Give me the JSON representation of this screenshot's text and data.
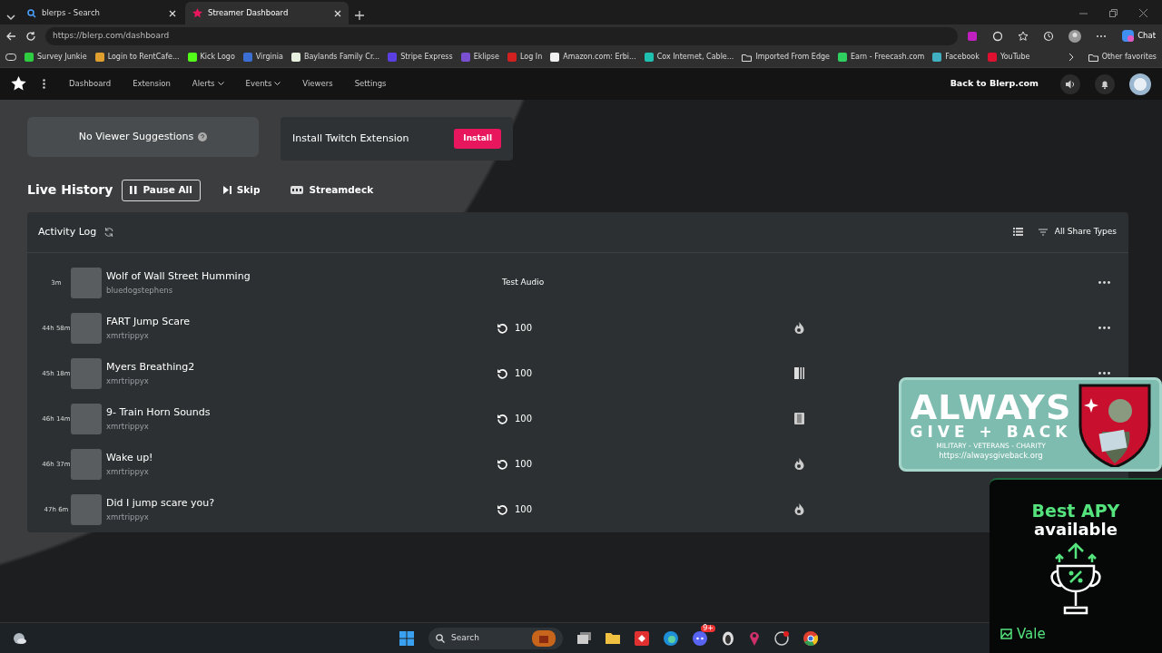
{
  "browser": {
    "tabs": [
      {
        "title": "blerps - Search",
        "selected": false
      },
      {
        "title": "Streamer Dashboard",
        "selected": true
      }
    ],
    "url": "https://blerp.com/dashboard",
    "bookmarks": [
      {
        "label": "Survey Junkie",
        "kind": "site",
        "color": "#2ecc40"
      },
      {
        "label": "Login to RentCafe...",
        "kind": "site",
        "color": "#e0a030"
      },
      {
        "label": "Kick Logo",
        "kind": "site",
        "color": "#53fc18"
      },
      {
        "label": "Virginia",
        "kind": "site",
        "color": "#3b6fd4"
      },
      {
        "label": "Baylands Family Cr...",
        "kind": "site",
        "color": "#e8f0e0"
      },
      {
        "label": "Stripe Express",
        "kind": "site",
        "color": "#5b3fe0"
      },
      {
        "label": "Eklipse",
        "kind": "site",
        "color": "#7a4fd0"
      },
      {
        "label": "Log In",
        "kind": "site",
        "color": "#d02020"
      },
      {
        "label": "Amazon.com: Erbi...",
        "kind": "site",
        "color": "#f0f0f0"
      },
      {
        "label": "Cox Internet, Cable...",
        "kind": "site",
        "color": "#20c0b0"
      },
      {
        "label": "Imported From Edge",
        "kind": "folder"
      },
      {
        "label": "Earn - Freecash.com",
        "kind": "site",
        "color": "#30d060"
      },
      {
        "label": "Facebook",
        "kind": "site",
        "color": "#40b0c0"
      },
      {
        "label": "YouTube",
        "kind": "site",
        "color": "#e01030"
      }
    ],
    "other_favorites": "Other favorites",
    "chat": "Chat"
  },
  "nav": {
    "links": [
      {
        "label": "Dashboard",
        "dropdown": false
      },
      {
        "label": "Extension",
        "dropdown": false
      },
      {
        "label": "Alerts",
        "dropdown": true
      },
      {
        "label": "Events",
        "dropdown": true
      },
      {
        "label": "Viewers",
        "dropdown": false
      },
      {
        "label": "Settings",
        "dropdown": false
      }
    ],
    "back_link": "Back to Blerp.com"
  },
  "suggestions": {
    "text": "No Viewer Suggestions"
  },
  "install": {
    "text": "Install Twitch Extension",
    "button": "Install"
  },
  "live_history": {
    "title": "Live History",
    "actions": [
      {
        "label": "Pause All",
        "kind": "pause",
        "outlined": true
      },
      {
        "label": "Skip",
        "kind": "skip",
        "outlined": false
      },
      {
        "label": "Streamdeck",
        "kind": "deck",
        "outlined": false
      }
    ]
  },
  "activity_log": {
    "title": "Activity Log",
    "filter": "All Share Types",
    "rows": [
      {
        "time": "3m",
        "title": "Wolf of Wall Street Humming",
        "user": "bluedogstephens",
        "kind": "test",
        "label": "Test Audio",
        "has_menu": true
      },
      {
        "time": "44h 58m",
        "title": "FART Jump Scare",
        "user": "xmrtrippyx",
        "kind": "volume",
        "label": "100",
        "media": {
          "kind": "flame"
        },
        "has_menu": true
      },
      {
        "time": "45h 18m",
        "title": "Myers Breathing2",
        "user": "xmrtrippyx",
        "kind": "volume",
        "label": "100",
        "media": {
          "kind": "bars"
        },
        "has_menu": true
      },
      {
        "time": "46h 14m",
        "title": "9- Train Horn Sounds",
        "user": "xmrtrippyx",
        "kind": "volume",
        "label": "100",
        "media": {
          "kind": "film"
        },
        "has_menu": false
      },
      {
        "time": "46h 37m",
        "title": "Wake up!",
        "user": "xmrtrippyx",
        "kind": "volume",
        "label": "100",
        "media": {
          "kind": "flame"
        },
        "has_menu": false
      },
      {
        "time": "47h 6m",
        "title": "Did I jump scare you?",
        "user": "xmrtrippyx",
        "kind": "volume",
        "label": "100",
        "media": {
          "kind": "flame"
        },
        "has_menu": false
      }
    ]
  },
  "charity_overlay": {
    "line_1": "ALWAYS",
    "line_2": "GIVE + BACK",
    "line_3": "MILITARY - VETERANS - CHARITY",
    "url": "https://alwaysgiveback.org"
  },
  "apy_overlay": {
    "line_1": "Best APY",
    "line_2": "available",
    "brand": "Vale"
  },
  "taskbar": {
    "search": "Search",
    "chat_badge": "9+"
  }
}
